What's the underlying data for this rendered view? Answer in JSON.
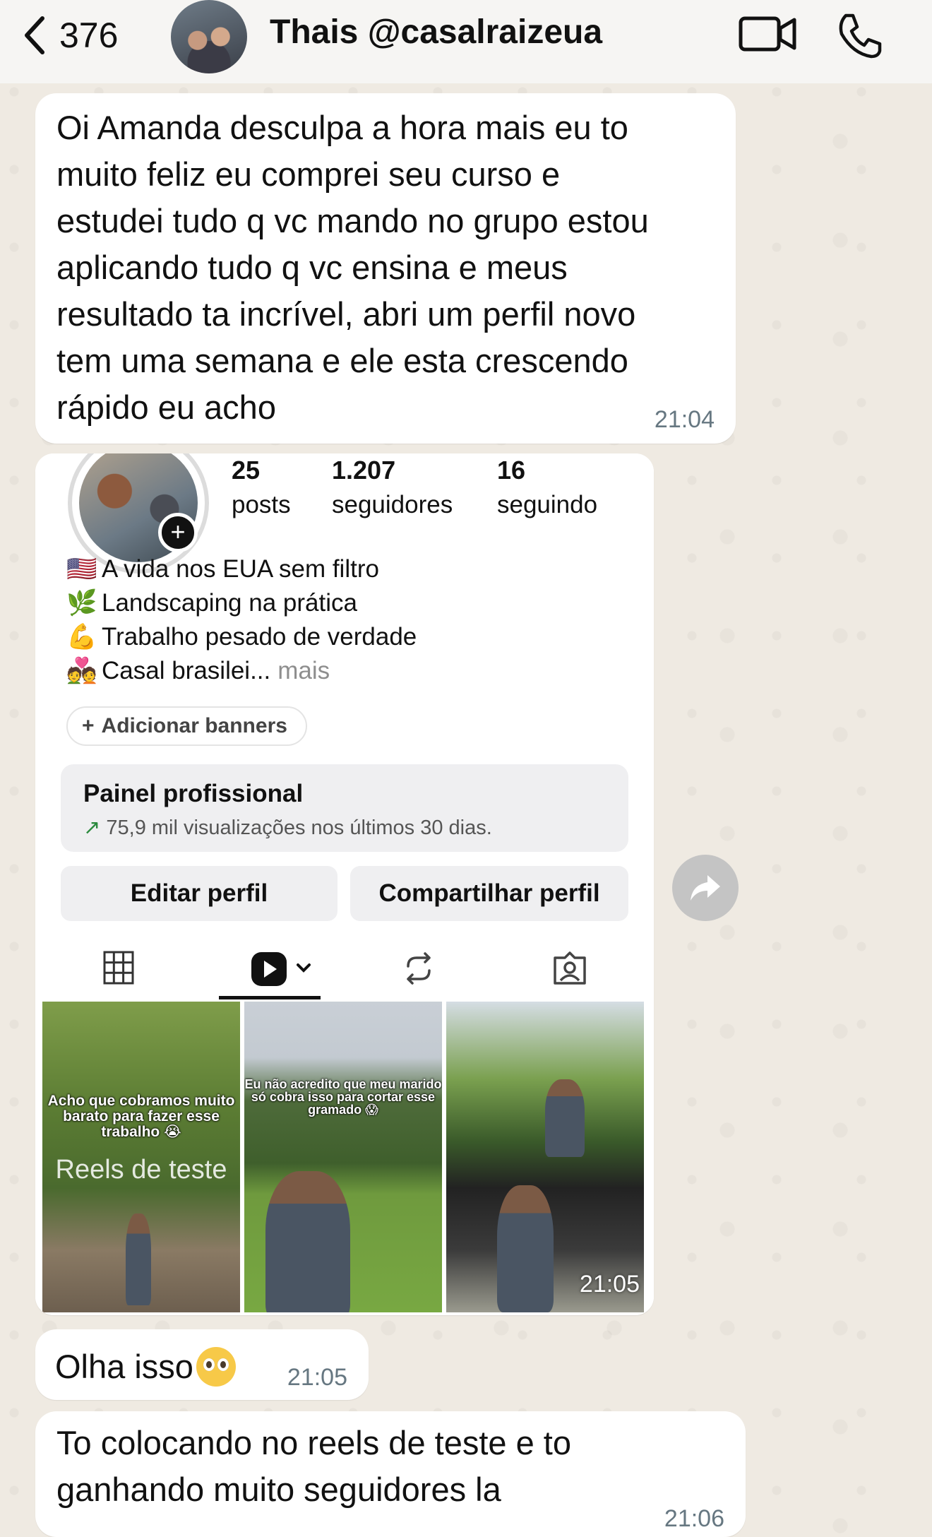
{
  "header": {
    "back_count": "376",
    "contact_name": "Thais @casalraizeua"
  },
  "messages": [
    {
      "text": "Oi Amanda desculpa a hora mais eu to\nmuito feliz eu comprei seu curso e\nestudei tudo q vc mando no grupo estou\naplicando tudo q vc ensina e meus\nresultado ta incrível, abri um perfil novo\ntem uma semana  e ele esta crescendo\nrápido eu acho",
      "time": "21:04"
    },
    {
      "type": "image",
      "time": "21:05",
      "profile": {
        "stats": [
          {
            "value": "25",
            "label": "posts"
          },
          {
            "value": "1.207",
            "label": "seguidores"
          },
          {
            "value": "16",
            "label": "seguindo"
          }
        ],
        "bio": [
          {
            "emoji": "🇺🇸",
            "text": "A vida nos EUA sem filtro"
          },
          {
            "emoji": "🌿",
            "text": "Landscaping na prática"
          },
          {
            "emoji": "💪",
            "text": "Trabalho pesado de verdade"
          },
          {
            "emoji": "💑",
            "text": "Casal brasilei...",
            "more": "mais"
          }
        ],
        "banner_button": "Adicionar banners",
        "panel_title": "Painel profissional",
        "panel_subtitle": "75,9 mil visualizações nos últimos 30 dias.",
        "edit_button": "Editar perfil",
        "share_button": "Compartilhar perfil",
        "tiles": [
          {
            "caption": "Acho que cobramos muito barato para fazer esse trabalho 😭",
            "overlay": "Reels de teste"
          },
          {
            "caption": "Eu não acredito que meu marido só cobra isso para cortar esse gramado 😱"
          },
          {
            "caption": ""
          }
        ]
      }
    },
    {
      "text": "Olha isso",
      "emoji": "🥺",
      "time": "21:05"
    },
    {
      "text": "To colocando no reels de teste e to\nganhando muito seguidores la",
      "time": "21:06"
    }
  ],
  "colors": {
    "chat_background": "#efeae2",
    "bubble": "#ffffff",
    "timestamp": "#667781"
  }
}
